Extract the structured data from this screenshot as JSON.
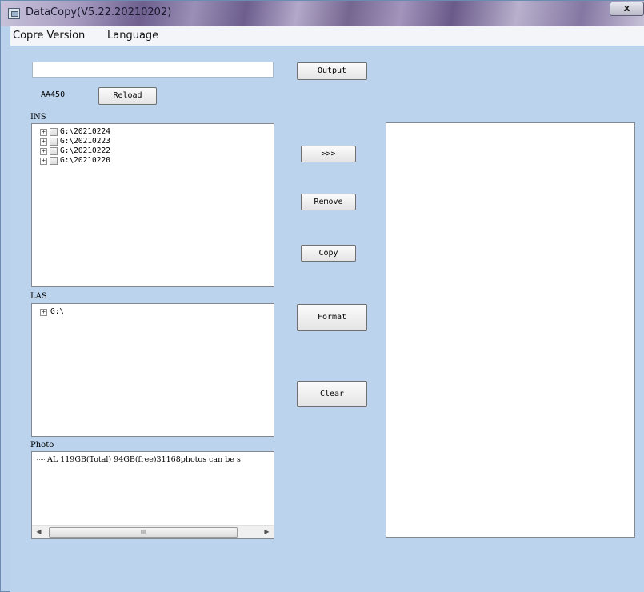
{
  "window": {
    "title": "DataCopy(V5.22.20210202)",
    "close_label": "x"
  },
  "menu": {
    "items": [
      "Copre Version",
      "Language"
    ]
  },
  "output": {
    "path_value": "",
    "button_label": "Output"
  },
  "device": {
    "label": "AA450",
    "reload_label": "Reload"
  },
  "ins": {
    "label": "INS",
    "items": [
      "G:\\20210224",
      "G:\\20210223",
      "G:\\20210222",
      "G:\\20210220"
    ]
  },
  "las": {
    "label": "LAS",
    "items": [
      "G:\\"
    ]
  },
  "photo": {
    "label": "Photo",
    "items": [
      "AL 119GB(Total) 94GB(free)31168photos can be s"
    ],
    "scroll_thumb_glyph": "III"
  },
  "actions": {
    "add_label": ">>>",
    "remove_label": "Remove",
    "copy_label": "Copy",
    "format_label": "Format",
    "clear_label": "Clear"
  },
  "icons": {
    "expand": "plus-box-icon",
    "scroll_left": "arrow-left-icon",
    "scroll_right": "arrow-right-icon"
  }
}
